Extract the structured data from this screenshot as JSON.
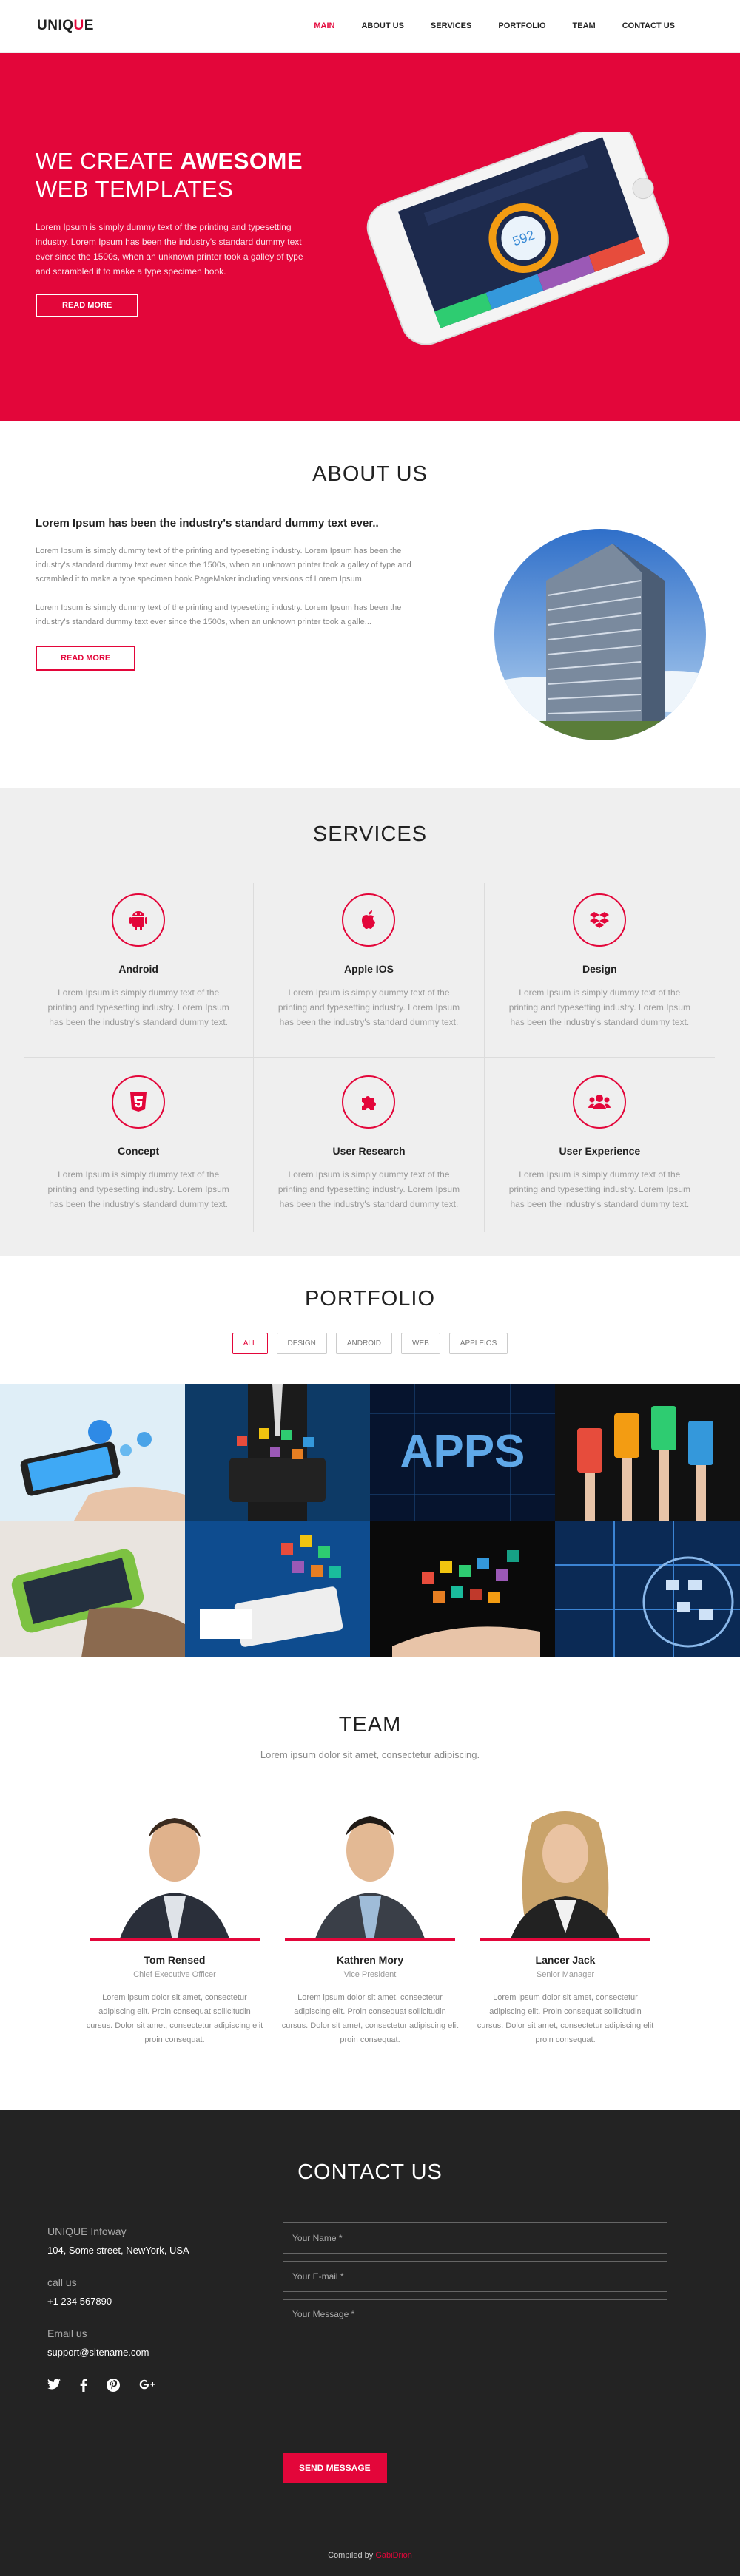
{
  "nav": {
    "logo_main": "UNIQ",
    "logo_accent": "U",
    "logo_end": "E",
    "items": [
      {
        "label": "MAIN",
        "active": true
      },
      {
        "label": "ABOUT US"
      },
      {
        "label": "SERVICES"
      },
      {
        "label": "PORTFOLIO"
      },
      {
        "label": "TEAM"
      },
      {
        "label": "CONTACT US"
      }
    ]
  },
  "hero": {
    "title_line1_pre": "WE CREATE",
    "title_line1_bold": "AWESOME",
    "title_line2": "WEB TEMPLATES",
    "description": "Lorem Ipsum is simply dummy text of the printing and typesetting industry. Lorem Ipsum has been the industry's standard dummy text ever since the 1500s, when an unknown printer took a galley of type and scrambled it to make a type specimen book.",
    "button": "READ MORE",
    "phone_reading": "592"
  },
  "about": {
    "title": "ABOUT US",
    "heading": "Lorem Ipsum has been the industry's standard dummy text ever..",
    "p1": "Lorem Ipsum is simply dummy text of the printing and typesetting industry. Lorem Ipsum has been the industry's standard dummy text ever since the 1500s, when an unknown printer took a galley of type and scrambled it to make a type specimen book.PageMaker including versions of Lorem Ipsum.",
    "p2": "Lorem Ipsum is simply dummy text of the printing and typesetting industry. Lorem Ipsum has been the industry's standard dummy text ever since the 1500s, when an unknown printer took a galle...",
    "button": "READ MORE"
  },
  "services": {
    "title": "SERVICES",
    "items": [
      {
        "name": "Android",
        "icon": "android-icon",
        "desc": "Lorem Ipsum is simply dummy text of the printing and typesetting industry. Lorem Ipsum has been the industry's standard dummy text."
      },
      {
        "name": "Apple IOS",
        "icon": "apple-icon",
        "desc": "Lorem Ipsum is simply dummy text of the printing and typesetting industry. Lorem Ipsum has been the industry's standard dummy text."
      },
      {
        "name": "Design",
        "icon": "dropbox-icon",
        "desc": "Lorem Ipsum is simply dummy text of the printing and typesetting industry. Lorem Ipsum has been the industry's standard dummy text."
      },
      {
        "name": "Concept",
        "icon": "html5-icon",
        "desc": "Lorem Ipsum is simply dummy text of the printing and typesetting industry. Lorem Ipsum has been the industry's standard dummy text."
      },
      {
        "name": "User Research",
        "icon": "puzzle-icon",
        "desc": "Lorem Ipsum is simply dummy text of the printing and typesetting industry. Lorem Ipsum has been the industry's standard dummy text."
      },
      {
        "name": "User Experience",
        "icon": "users-icon",
        "desc": "Lorem Ipsum is simply dummy text of the printing and typesetting industry. Lorem Ipsum has been the industry's standard dummy text."
      }
    ]
  },
  "portfolio": {
    "title": "PORTFOLIO",
    "filters": [
      "ALL",
      "DESIGN",
      "ANDROID",
      "WEB",
      "APPLEIOS"
    ],
    "tile_apps_text": "APPS"
  },
  "team": {
    "title": "TEAM",
    "subtitle": "Lorem ipsum dolor sit amet, consectetur adipiscing.",
    "members": [
      {
        "name": "Tom Rensed",
        "role": "Chief Executive Officer",
        "desc": "Lorem ipsum dolor sit amet, consectetur adipiscing elit. Proin consequat sollicitudin cursus. Dolor sit amet, consectetur adipiscing elit proin consequat."
      },
      {
        "name": "Kathren Mory",
        "role": "Vice President",
        "desc": "Lorem ipsum dolor sit amet, consectetur adipiscing elit. Proin consequat sollicitudin cursus. Dolor sit amet, consectetur adipiscing elit proin consequat."
      },
      {
        "name": "Lancer Jack",
        "role": "Senior Manager",
        "desc": "Lorem ipsum dolor sit amet, consectetur adipiscing elit. Proin consequat sollicitudin cursus. Dolor sit amet, consectetur adipiscing elit proin consequat."
      }
    ]
  },
  "contact": {
    "title": "CONTACT US",
    "company_label": "UNIQUE Infoway",
    "address": "104, Some street, NewYork, USA",
    "call_label": "call us",
    "phone": "+1 234 567890",
    "email_label": "Email us",
    "email": "support@sitename.com",
    "name_placeholder": "Your Name *",
    "email_placeholder": "Your E-mail *",
    "message_placeholder": "Your Message *",
    "send_button": "SEND MESSAGE"
  },
  "footer": {
    "compiled_by": "Compiled by",
    "author": "GabiDrion"
  },
  "colors": {
    "accent": "#e3063a",
    "dark": "#232323",
    "light_bg": "#efefef"
  }
}
